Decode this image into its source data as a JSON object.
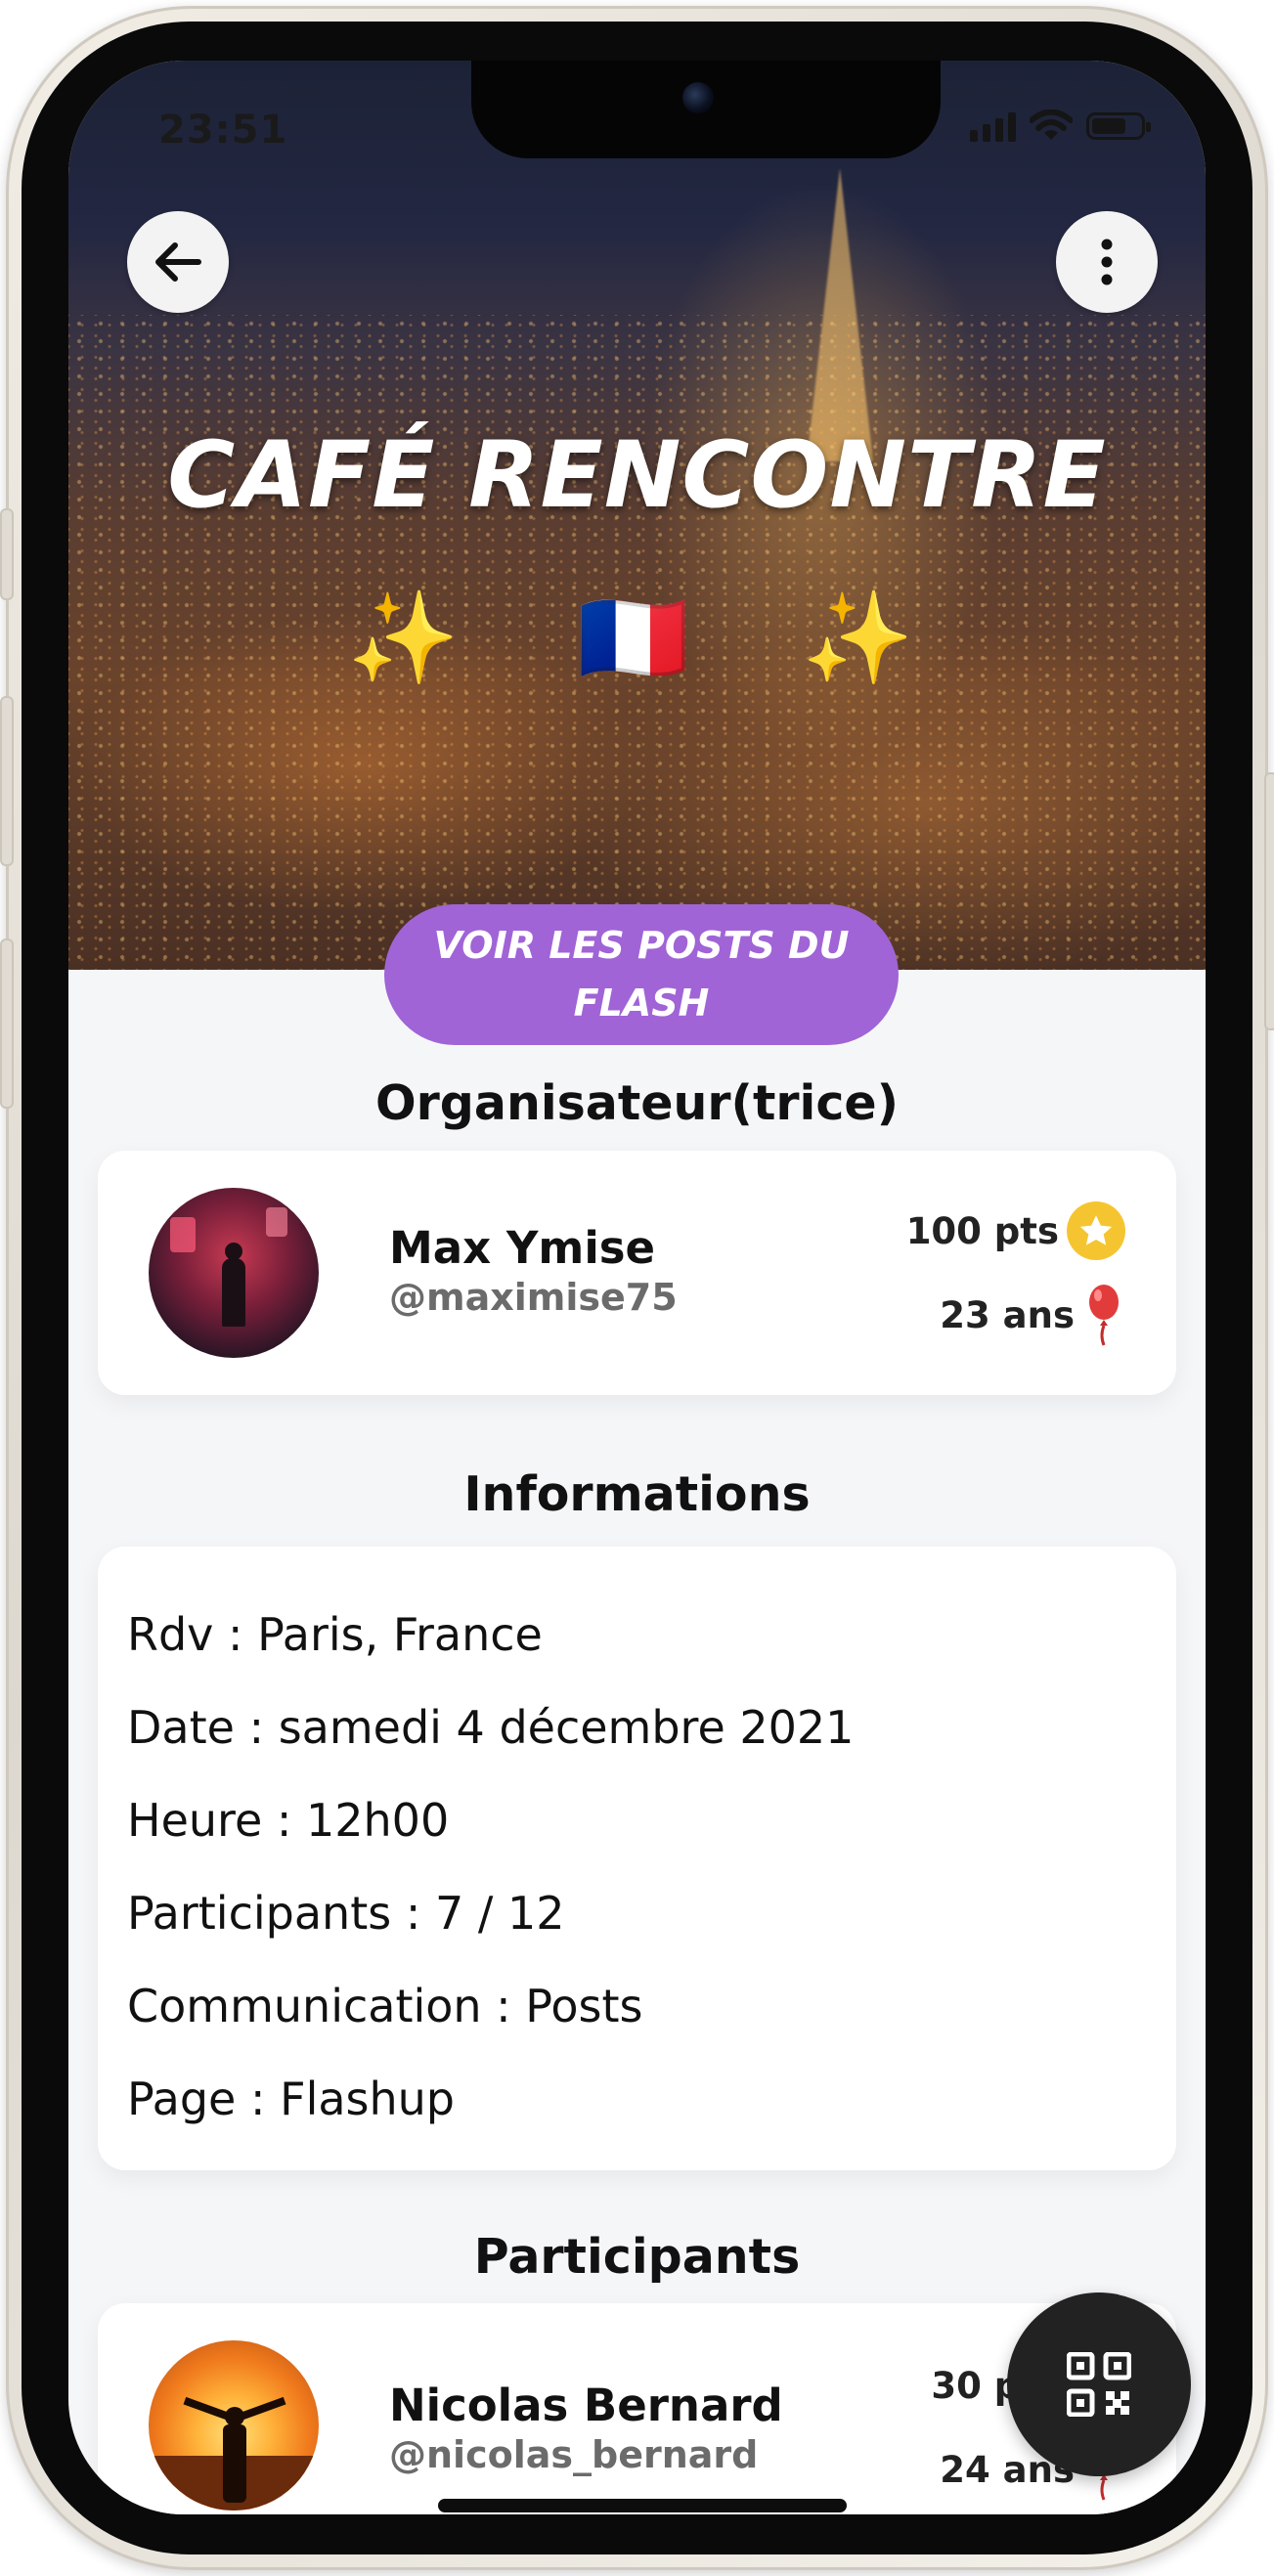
{
  "status_bar": {
    "time": "23:51",
    "battery_level": 0.7
  },
  "hero": {
    "title": "CAFÉ RENCONTRE",
    "emoji_left": "✨",
    "emoji_center": "🇫🇷",
    "emoji_right": "✨"
  },
  "cta": {
    "label": "VOIR LES POSTS DU FLASH"
  },
  "organizer": {
    "section_title": "Organisateur(trice)",
    "name": "Max Ymise",
    "handle": "@maximise75",
    "points": "100 pts",
    "age": "23 ans"
  },
  "informations": {
    "section_title": "Informations",
    "lines": [
      "Rdv : Paris, France",
      "Date : samedi 4 décembre 2021",
      "Heure : 12h00",
      "Participants : 7 / 12",
      "Communication : Posts",
      "Page : Flashup"
    ]
  },
  "participants": {
    "section_title": "Participants",
    "items": [
      {
        "name": "Nicolas Bernard",
        "handle": "@nicolas_bernard",
        "points": "30 pts",
        "age": "24 ans"
      }
    ]
  },
  "colors": {
    "accent": "#a064d6",
    "star": "#f5c531",
    "pin": "#e23b3b"
  },
  "icons": {
    "back": "arrow-left-icon",
    "more": "more-vertical-icon",
    "star": "star-icon",
    "pin": "balloon-pin-icon",
    "qr": "qr-code-icon"
  }
}
